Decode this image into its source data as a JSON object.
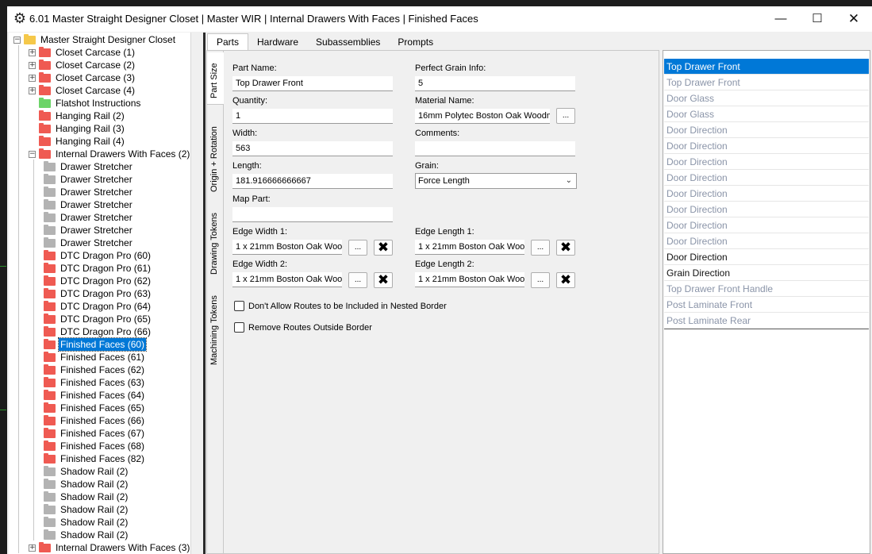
{
  "window": {
    "title": "6.01 Master Straight Designer Closet | Master WIR | Internal Drawers With Faces | Finished Faces",
    "icon": "gear-icon"
  },
  "tree": {
    "root": "Master Straight Designer Closet",
    "items": [
      {
        "label": "Closet Carcase (1)",
        "color": "red",
        "level": 1,
        "expander": "+"
      },
      {
        "label": "Closet Carcase (2)",
        "color": "red",
        "level": 1,
        "expander": "+"
      },
      {
        "label": "Closet Carcase (3)",
        "color": "red",
        "level": 1,
        "expander": "+"
      },
      {
        "label": "Closet Carcase (4)",
        "color": "red",
        "level": 1,
        "expander": "+"
      },
      {
        "label": "Flatshot Instructions",
        "color": "green",
        "level": 1,
        "expander": ""
      },
      {
        "label": "Hanging Rail (2)",
        "color": "red",
        "level": 1,
        "expander": ""
      },
      {
        "label": "Hanging Rail (3)",
        "color": "red",
        "level": 1,
        "expander": ""
      },
      {
        "label": "Hanging Rail (4)",
        "color": "red",
        "level": 1,
        "expander": ""
      },
      {
        "label": "Internal Drawers With Faces (2)",
        "color": "red",
        "level": 1,
        "expander": "−"
      },
      {
        "label": "Drawer Stretcher",
        "color": "grey",
        "level": 2,
        "expander": ""
      },
      {
        "label": "Drawer Stretcher",
        "color": "grey",
        "level": 2,
        "expander": ""
      },
      {
        "label": "Drawer Stretcher",
        "color": "grey",
        "level": 2,
        "expander": ""
      },
      {
        "label": "Drawer Stretcher",
        "color": "grey",
        "level": 2,
        "expander": ""
      },
      {
        "label": "Drawer Stretcher",
        "color": "grey",
        "level": 2,
        "expander": ""
      },
      {
        "label": "Drawer Stretcher",
        "color": "grey",
        "level": 2,
        "expander": ""
      },
      {
        "label": "Drawer Stretcher",
        "color": "grey",
        "level": 2,
        "expander": ""
      },
      {
        "label": "DTC Dragon Pro (60)",
        "color": "red",
        "level": 2,
        "expander": ""
      },
      {
        "label": "DTC Dragon Pro (61)",
        "color": "red",
        "level": 2,
        "expander": ""
      },
      {
        "label": "DTC Dragon Pro (62)",
        "color": "red",
        "level": 2,
        "expander": ""
      },
      {
        "label": "DTC Dragon Pro (63)",
        "color": "red",
        "level": 2,
        "expander": ""
      },
      {
        "label": "DTC Dragon Pro (64)",
        "color": "red",
        "level": 2,
        "expander": ""
      },
      {
        "label": "DTC Dragon Pro (65)",
        "color": "red",
        "level": 2,
        "expander": ""
      },
      {
        "label": "DTC Dragon Pro (66)",
        "color": "red",
        "level": 2,
        "expander": ""
      },
      {
        "label": "Finished Faces (60)",
        "color": "red",
        "level": 2,
        "expander": "",
        "selected": true
      },
      {
        "label": "Finished Faces (61)",
        "color": "red",
        "level": 2,
        "expander": ""
      },
      {
        "label": "Finished Faces (62)",
        "color": "red",
        "level": 2,
        "expander": ""
      },
      {
        "label": "Finished Faces (63)",
        "color": "red",
        "level": 2,
        "expander": ""
      },
      {
        "label": "Finished Faces (64)",
        "color": "red",
        "level": 2,
        "expander": ""
      },
      {
        "label": "Finished Faces (65)",
        "color": "red",
        "level": 2,
        "expander": ""
      },
      {
        "label": "Finished Faces (66)",
        "color": "red",
        "level": 2,
        "expander": ""
      },
      {
        "label": "Finished Faces (67)",
        "color": "red",
        "level": 2,
        "expander": ""
      },
      {
        "label": "Finished Faces (68)",
        "color": "red",
        "level": 2,
        "expander": ""
      },
      {
        "label": "Finished Faces (82)",
        "color": "red",
        "level": 2,
        "expander": ""
      },
      {
        "label": "Shadow Rail (2)",
        "color": "grey",
        "level": 2,
        "expander": ""
      },
      {
        "label": "Shadow Rail (2)",
        "color": "grey",
        "level": 2,
        "expander": ""
      },
      {
        "label": "Shadow Rail (2)",
        "color": "grey",
        "level": 2,
        "expander": ""
      },
      {
        "label": "Shadow Rail (2)",
        "color": "grey",
        "level": 2,
        "expander": ""
      },
      {
        "label": "Shadow Rail (2)",
        "color": "grey",
        "level": 2,
        "expander": ""
      },
      {
        "label": "Shadow Rail (2)",
        "color": "grey",
        "level": 2,
        "expander": ""
      },
      {
        "label": "Internal Drawers With Faces (3)",
        "color": "red",
        "level": 1,
        "expander": "+"
      }
    ]
  },
  "tabs": [
    "Parts",
    "Hardware",
    "Subassemblies",
    "Prompts"
  ],
  "vertical_tabs": [
    "Part Size",
    "Origin + Rotation",
    "Drawing Tokens",
    "Machining Tokens"
  ],
  "form": {
    "part_name_label": "Part Name:",
    "part_name": "Top Drawer Front",
    "perfect_grain_label": "Perfect Grain Info:",
    "perfect_grain": "5",
    "quantity_label": "Quantity:",
    "quantity": "1",
    "material_label": "Material Name:",
    "material": "16mm Polytec Boston Oak Woodm",
    "width_label": "Width:",
    "width": "563",
    "comments_label": "Comments:",
    "comments": "",
    "length_label": "Length:",
    "length": "181.916666666667",
    "grain_label": "Grain:",
    "grain": "Force Length",
    "map_part_label": "Map Part:",
    "map_part": "",
    "edge_width1_label": "Edge Width 1:",
    "edge_width1": "1 x 21mm Boston Oak Wooc",
    "edge_length1_label": "Edge Length 1:",
    "edge_length1": "1 x 21mm Boston Oak Wooc",
    "edge_width2_label": "Edge  Width 2:",
    "edge_width2": "1 x 21mm Boston Oak Wooc",
    "edge_length2_label": "Edge Length 2:",
    "edge_length2": "1 x 21mm Boston Oak Wooc",
    "dots_label": "...",
    "x_label": "✖",
    "chk_routes_nested": "Don't Allow Routes to be Included in Nested Border",
    "chk_remove_routes": "Remove Routes Outside Border"
  },
  "parts_list": [
    {
      "label": "Top Drawer Front",
      "state": "selected"
    },
    {
      "label": "Top Drawer Front",
      "state": "dim"
    },
    {
      "label": "Door Glass",
      "state": "dim"
    },
    {
      "label": "Door Glass",
      "state": "dim"
    },
    {
      "label": "Door Direction",
      "state": "dim"
    },
    {
      "label": "Door Direction",
      "state": "dim"
    },
    {
      "label": "Door Direction",
      "state": "dim"
    },
    {
      "label": "Door Direction",
      "state": "dim"
    },
    {
      "label": "Door Direction",
      "state": "dim"
    },
    {
      "label": "Door Direction",
      "state": "dim"
    },
    {
      "label": "Door Direction",
      "state": "dim"
    },
    {
      "label": "Door Direction",
      "state": "dim"
    },
    {
      "label": "Door Direction",
      "state": "dark"
    },
    {
      "label": "Grain Direction",
      "state": "dark"
    },
    {
      "label": "Top Drawer Front Handle",
      "state": "dim"
    },
    {
      "label": "Post Laminate Front",
      "state": "dim"
    },
    {
      "label": "Post Laminate Rear",
      "state": "dim"
    }
  ],
  "colors": {
    "selection": "#0078d7",
    "folder_red": "#ef5a52",
    "folder_green": "#6cd468",
    "folder_grey": "#b3b3b3"
  }
}
